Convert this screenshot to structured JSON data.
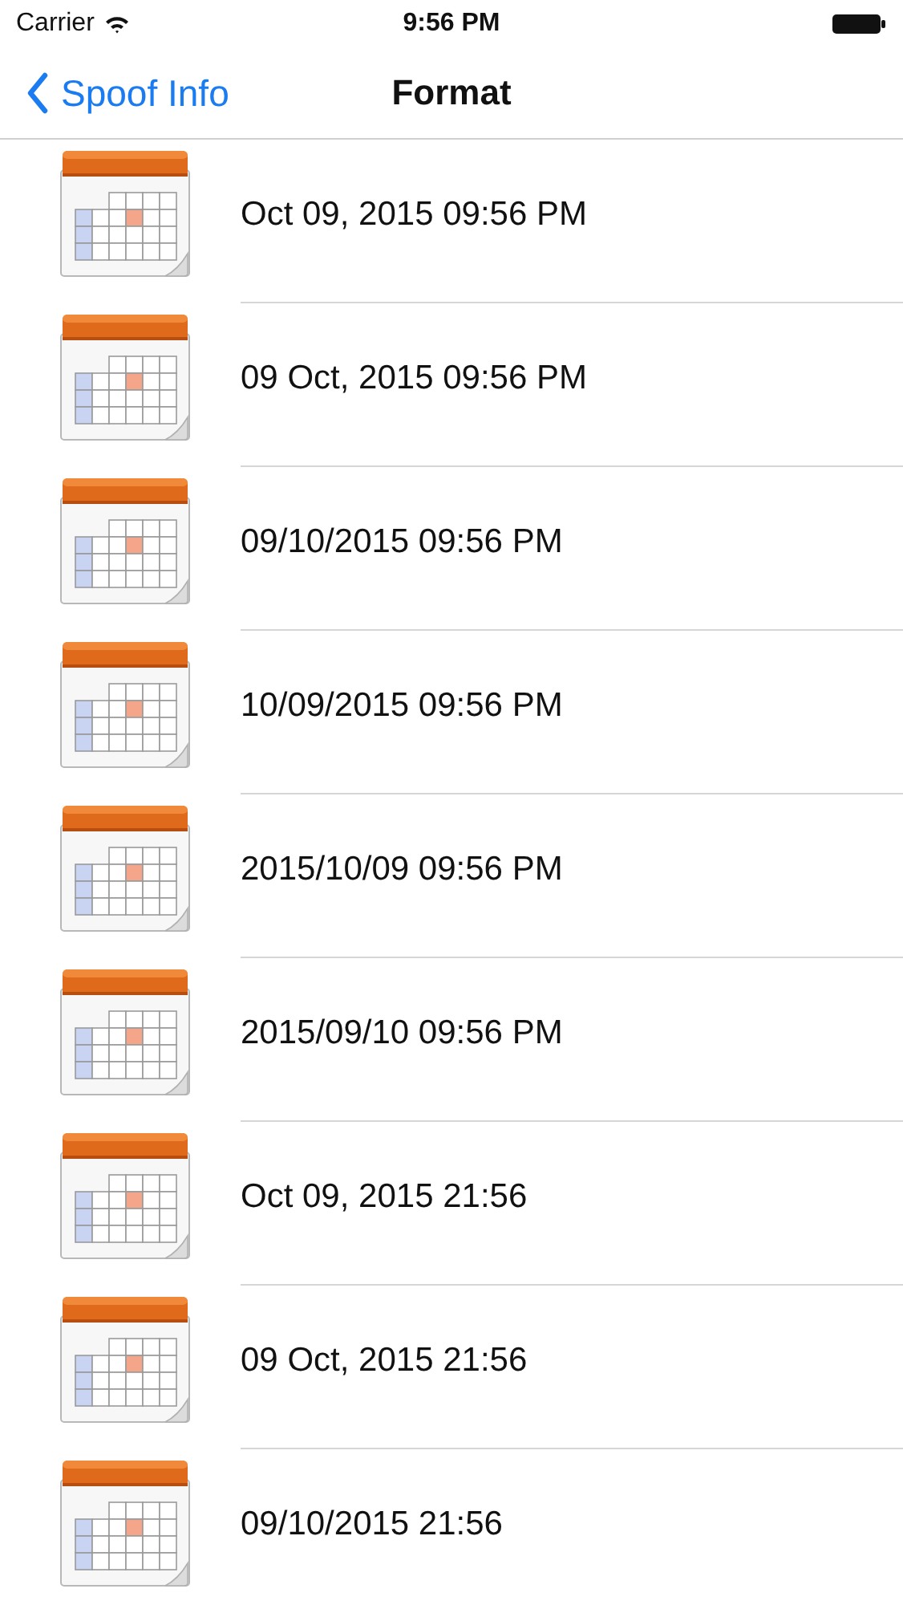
{
  "status_bar": {
    "carrier": "Carrier",
    "time": "9:56 PM"
  },
  "nav_bar": {
    "back": "Spoof Info",
    "title": "Format"
  },
  "rows": [
    {
      "label": "Oct 09, 2015 09:56 PM"
    },
    {
      "label": "09 Oct, 2015 09:56 PM"
    },
    {
      "label": "09/10/2015 09:56 PM"
    },
    {
      "label": "10/09/2015 09:56 PM"
    },
    {
      "label": "2015/10/09 09:56 PM"
    },
    {
      "label": "2015/09/10 09:56 PM"
    },
    {
      "label": "Oct 09, 2015 21:56"
    },
    {
      "label": "09 Oct, 2015 21:56"
    },
    {
      "label": "09/10/2015 21:56"
    }
  ]
}
